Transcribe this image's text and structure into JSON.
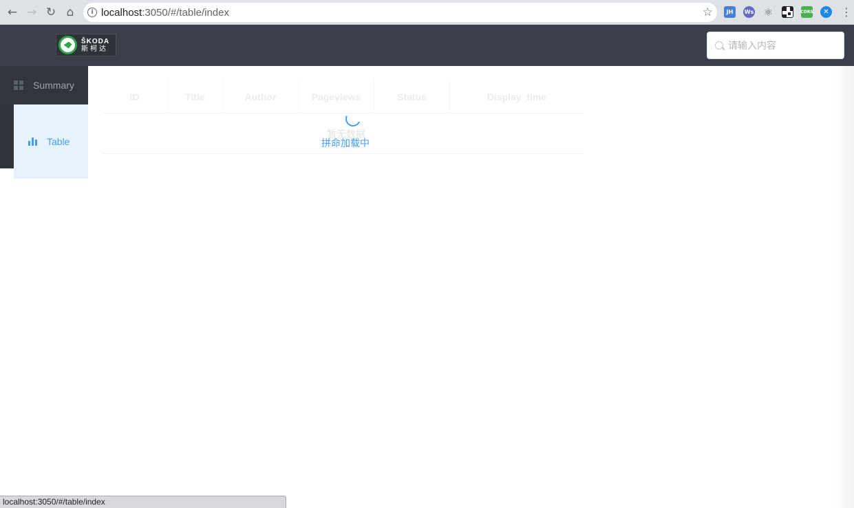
{
  "browser": {
    "url_host": "localhost",
    "url_rest": ":3050/#/table/index",
    "status_url": "localhost:3050/#/table/index",
    "extensions": [
      {
        "icon": "jh-extension-icon",
        "label": "JH",
        "color": "#4a7fd6"
      },
      {
        "icon": "ws-extension-icon",
        "label": "Ws",
        "color": "#6b66c9"
      },
      {
        "icon": "react-devtools-icon",
        "label": "⚛",
        "color": "#5f6368"
      },
      {
        "icon": "qr-code-icon",
        "label": "",
        "color": "#202124"
      },
      {
        "icon": "cors-extension-icon",
        "label": "CORS",
        "color": "#4caf50"
      },
      {
        "icon": "blue-extension-icon",
        "label": "✕",
        "color": "#1e88e5"
      }
    ]
  },
  "header": {
    "logo_line1": "ŠKODA",
    "logo_line2": "斯柯达",
    "search_placeholder": "请输入内容"
  },
  "sidebar": {
    "items": [
      {
        "label": "Summary",
        "icon": "grid-icon",
        "active": false
      },
      {
        "label": "Table",
        "icon": "bar-chart-icon",
        "active": true
      }
    ]
  },
  "table": {
    "columns": [
      "ID",
      "Title",
      "Author",
      "Pageviews",
      "Status",
      "Display_time"
    ],
    "empty_text": "暂无数据",
    "loading_text": "拼命加载中"
  },
  "colors": {
    "accent": "#409eff",
    "header_bg": "#3a3f49",
    "sidebar_bg": "#2e333c"
  }
}
